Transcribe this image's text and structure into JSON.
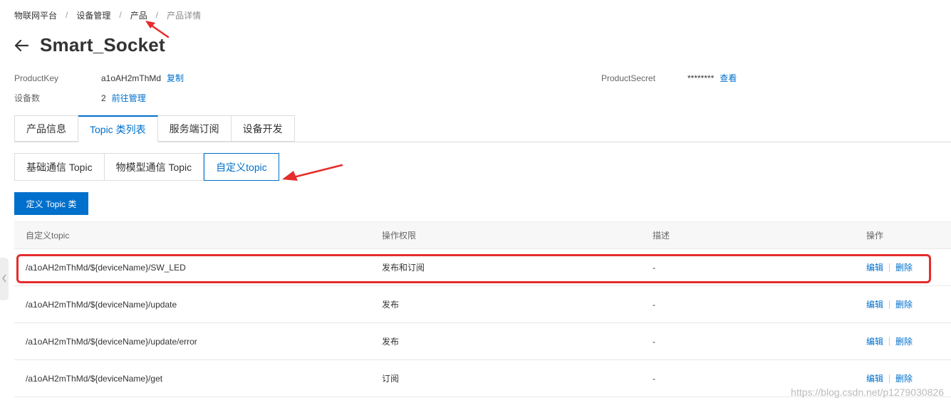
{
  "breadcrumb": [
    "物联网平台",
    "设备管理",
    "产品",
    "产品详情"
  ],
  "breadcrumb_sep": "/",
  "title": "Smart_Socket",
  "info": {
    "product_key_label": "ProductKey",
    "product_key_value": "a1oAH2mThMd",
    "copy_link": "复制",
    "product_secret_label": "ProductSecret",
    "product_secret_value": "********",
    "view_link": "查看",
    "device_count_label": "设备数",
    "device_count_value": "2",
    "manage_link": "前往管理"
  },
  "tabs": [
    "产品信息",
    "Topic 类列表",
    "服务端订阅",
    "设备开发"
  ],
  "active_tab": 1,
  "subtabs": [
    "基础通信 Topic",
    "物模型通信 Topic",
    "自定义topic"
  ],
  "active_subtab": 2,
  "define_button": "定义 Topic 类",
  "table": {
    "headers": [
      "自定义topic",
      "操作权限",
      "描述",
      "操作"
    ],
    "rows": [
      {
        "topic": "/a1oAH2mThMd/${deviceName}/SW_LED",
        "permission": "发布和订阅",
        "desc": "-",
        "edit": "编辑",
        "delete": "删除"
      },
      {
        "topic": "/a1oAH2mThMd/${deviceName}/update",
        "permission": "发布",
        "desc": "-",
        "edit": "编辑",
        "delete": "删除"
      },
      {
        "topic": "/a1oAH2mThMd/${deviceName}/update/error",
        "permission": "发布",
        "desc": "-",
        "edit": "编辑",
        "delete": "删除"
      },
      {
        "topic": "/a1oAH2mThMd/${deviceName}/get",
        "permission": "订阅",
        "desc": "-",
        "edit": "编辑",
        "delete": "删除"
      }
    ]
  },
  "watermark": "https://blog.csdn.net/p1279030826",
  "colors": {
    "primary": "#0070cc",
    "annotation": "#e62c2c"
  },
  "icons": {
    "back": "arrow-left-icon",
    "side": "chevron-left-icon"
  }
}
